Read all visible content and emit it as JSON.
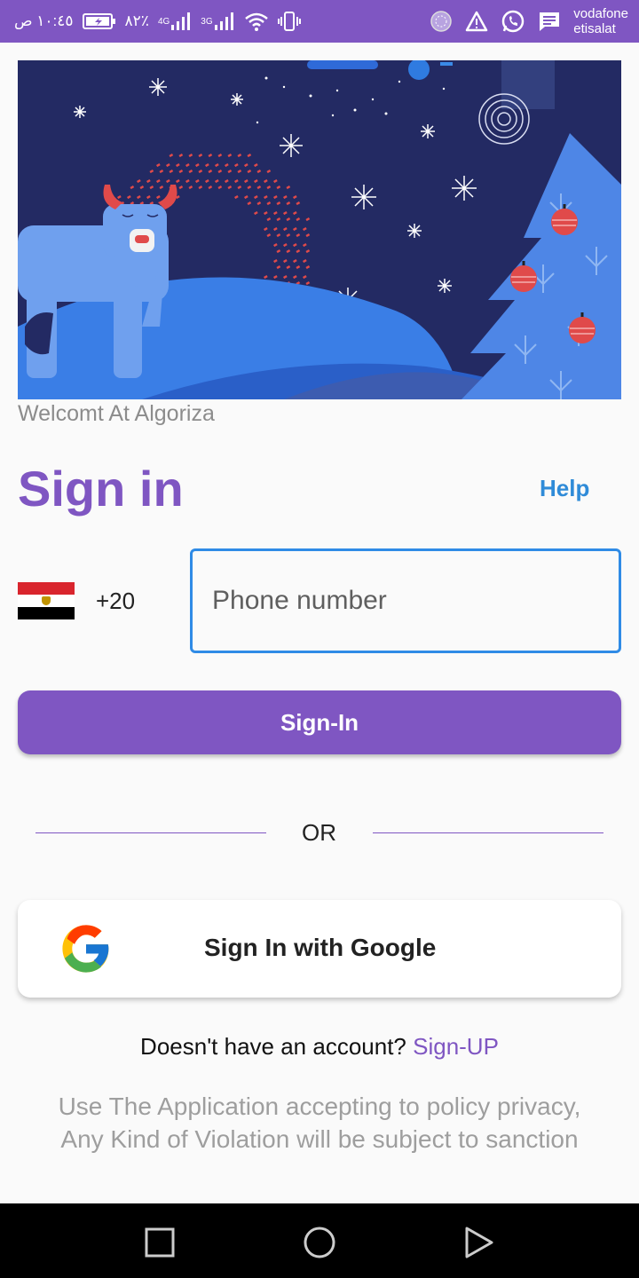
{
  "status_bar": {
    "time": "١٠:٤٥ ص",
    "battery": "٨٢٪",
    "signal_1_label": "4G",
    "signal_2_label": "3G",
    "carrier_1": "vodafone",
    "carrier_2": "etisalat",
    "bg_color": "#7f56c2"
  },
  "welcome_text": "Welcomt At Algoriza",
  "title": "Sign in",
  "help_label": "Help",
  "phone": {
    "dial_code": "+20",
    "placeholder": "Phone number",
    "value": ""
  },
  "signin_button_label": "Sign-In",
  "or_label": "OR",
  "google_button_label": "Sign In with Google",
  "signup": {
    "prompt": "Doesn't have an account? ",
    "link_label": "Sign-UP"
  },
  "policy": {
    "line1": "Use The Application accepting to policy privacy,",
    "line2": "Any Kind of Violation will be subject to sanction"
  },
  "colors": {
    "primary": "#7f56c2",
    "help": "#2f8bd8",
    "input_border": "#2f8be6"
  }
}
